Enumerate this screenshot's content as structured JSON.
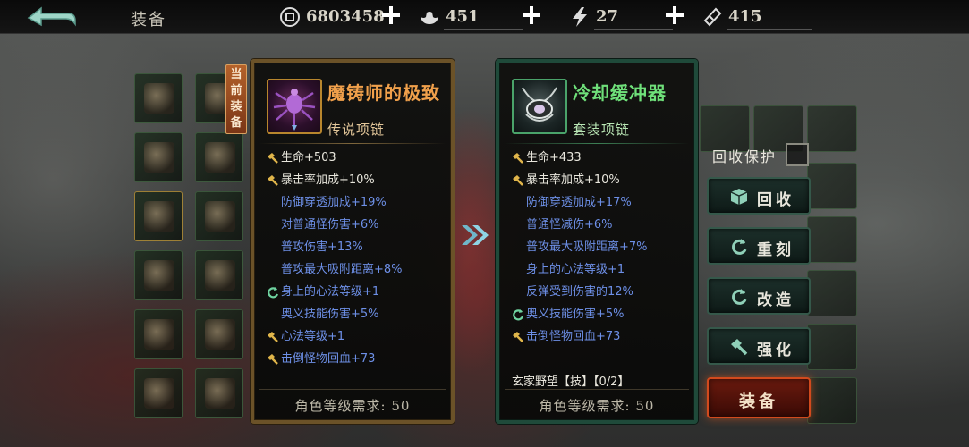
{
  "topbar": {
    "title": "装备",
    "resources": [
      {
        "icon": "coin-icon",
        "value": "6803458"
      },
      {
        "icon": "ingot-icon",
        "value": "451"
      },
      {
        "icon": "lightning-icon",
        "value": "27"
      },
      {
        "icon": "ticket-icon",
        "value": "415"
      }
    ]
  },
  "current_tag": "当前装备",
  "current_item": {
    "name": "魔铸师的极致",
    "type": "传说项链",
    "name_color": "#f0a04b",
    "stats": [
      {
        "icon": "hammer-icon",
        "text": "生命+503",
        "style": "base"
      },
      {
        "icon": "hammer-icon",
        "text": "暴击率加成+10%",
        "style": "base"
      },
      {
        "icon": "",
        "text": "防御穿透加成+19%",
        "style": "blue"
      },
      {
        "icon": "",
        "text": "对普通怪伤害+6%",
        "style": "blue"
      },
      {
        "icon": "",
        "text": "普攻伤害+13%",
        "style": "blue"
      },
      {
        "icon": "",
        "text": "普攻最大吸附距离+8%",
        "style": "blue"
      },
      {
        "icon": "refresh-icon",
        "text": "身上的心法等级+1",
        "style": "blue"
      },
      {
        "icon": "",
        "text": "奥义技能伤害+5%",
        "style": "blue"
      },
      {
        "icon": "hammer-icon",
        "text": "心法等级+1",
        "style": "blue"
      },
      {
        "icon": "hammer-icon",
        "text": "击倒怪物回血+73",
        "style": "blue"
      }
    ],
    "requirement": "角色等级需求: 50"
  },
  "new_item": {
    "name": "冷却缓冲器",
    "type": "套装项链",
    "name_color": "#6fe07a",
    "stats": [
      {
        "icon": "hammer-icon",
        "text": "生命+433",
        "style": "base"
      },
      {
        "icon": "hammer-icon",
        "text": "暴击率加成+10%",
        "style": "base"
      },
      {
        "icon": "",
        "text": "防御穿透加成+17%",
        "style": "blue"
      },
      {
        "icon": "",
        "text": "普通怪减伤+6%",
        "style": "blue"
      },
      {
        "icon": "",
        "text": "普攻最大吸附距离+7%",
        "style": "blue"
      },
      {
        "icon": "",
        "text": "身上的心法等级+1",
        "style": "blue"
      },
      {
        "icon": "",
        "text": "反弹受到伤害的12%",
        "style": "blue"
      },
      {
        "icon": "refresh-icon",
        "text": "奥义技能伤害+5%",
        "style": "blue"
      },
      {
        "icon": "hammer-icon",
        "text": "击倒怪物回血+73",
        "style": "blue"
      }
    ],
    "set_line": "玄家野望【技】【0/2】",
    "requirement": "角色等级需求: 50"
  },
  "actions": {
    "recycle_protect_label": "回收保护",
    "recycle_label": "回收",
    "reforge_label": "重刻",
    "modify_label": "改造",
    "enhance_label": "强化",
    "equip_label": "装备"
  }
}
